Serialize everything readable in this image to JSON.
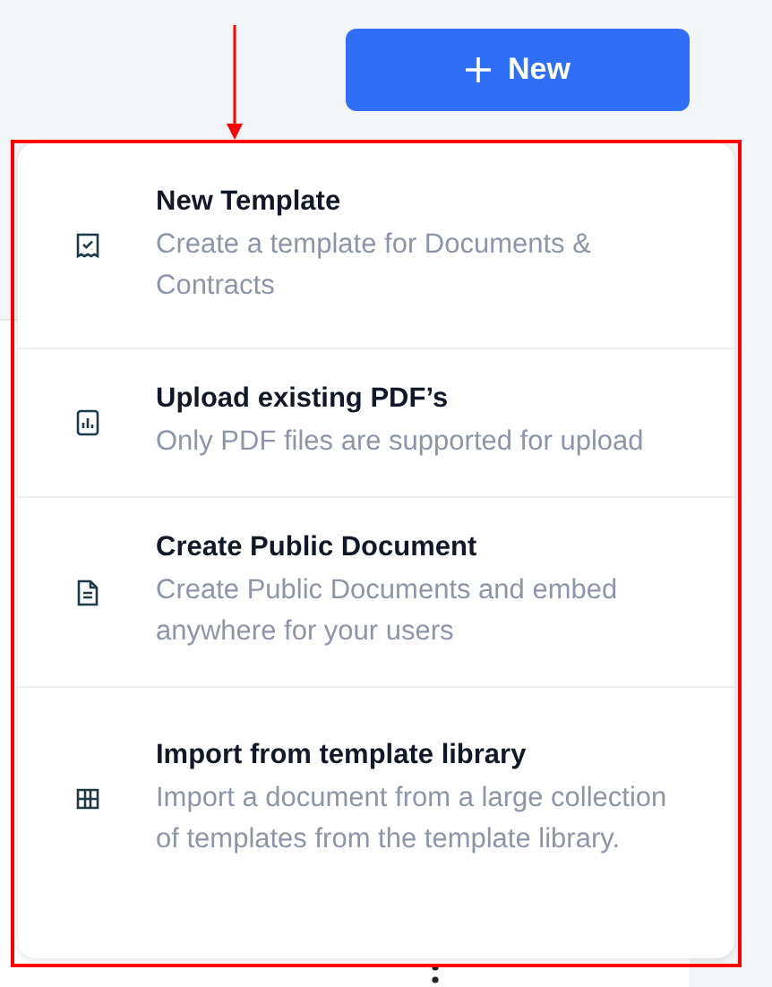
{
  "new_button": {
    "label": "New"
  },
  "menu": {
    "items": [
      {
        "kind": "template",
        "title": "New Template",
        "description": "Create a template for Documents & Contracts"
      },
      {
        "kind": "upload",
        "title": "Upload existing PDF’s",
        "description": "Only PDF files are supported for upload"
      },
      {
        "kind": "public",
        "title": "Create Public Document",
        "description": "Create Public Documents and embed anywhere for your users"
      },
      {
        "kind": "library",
        "title": "Import from template library",
        "description": "Import a document from a large collection of templates from the template library."
      }
    ]
  }
}
